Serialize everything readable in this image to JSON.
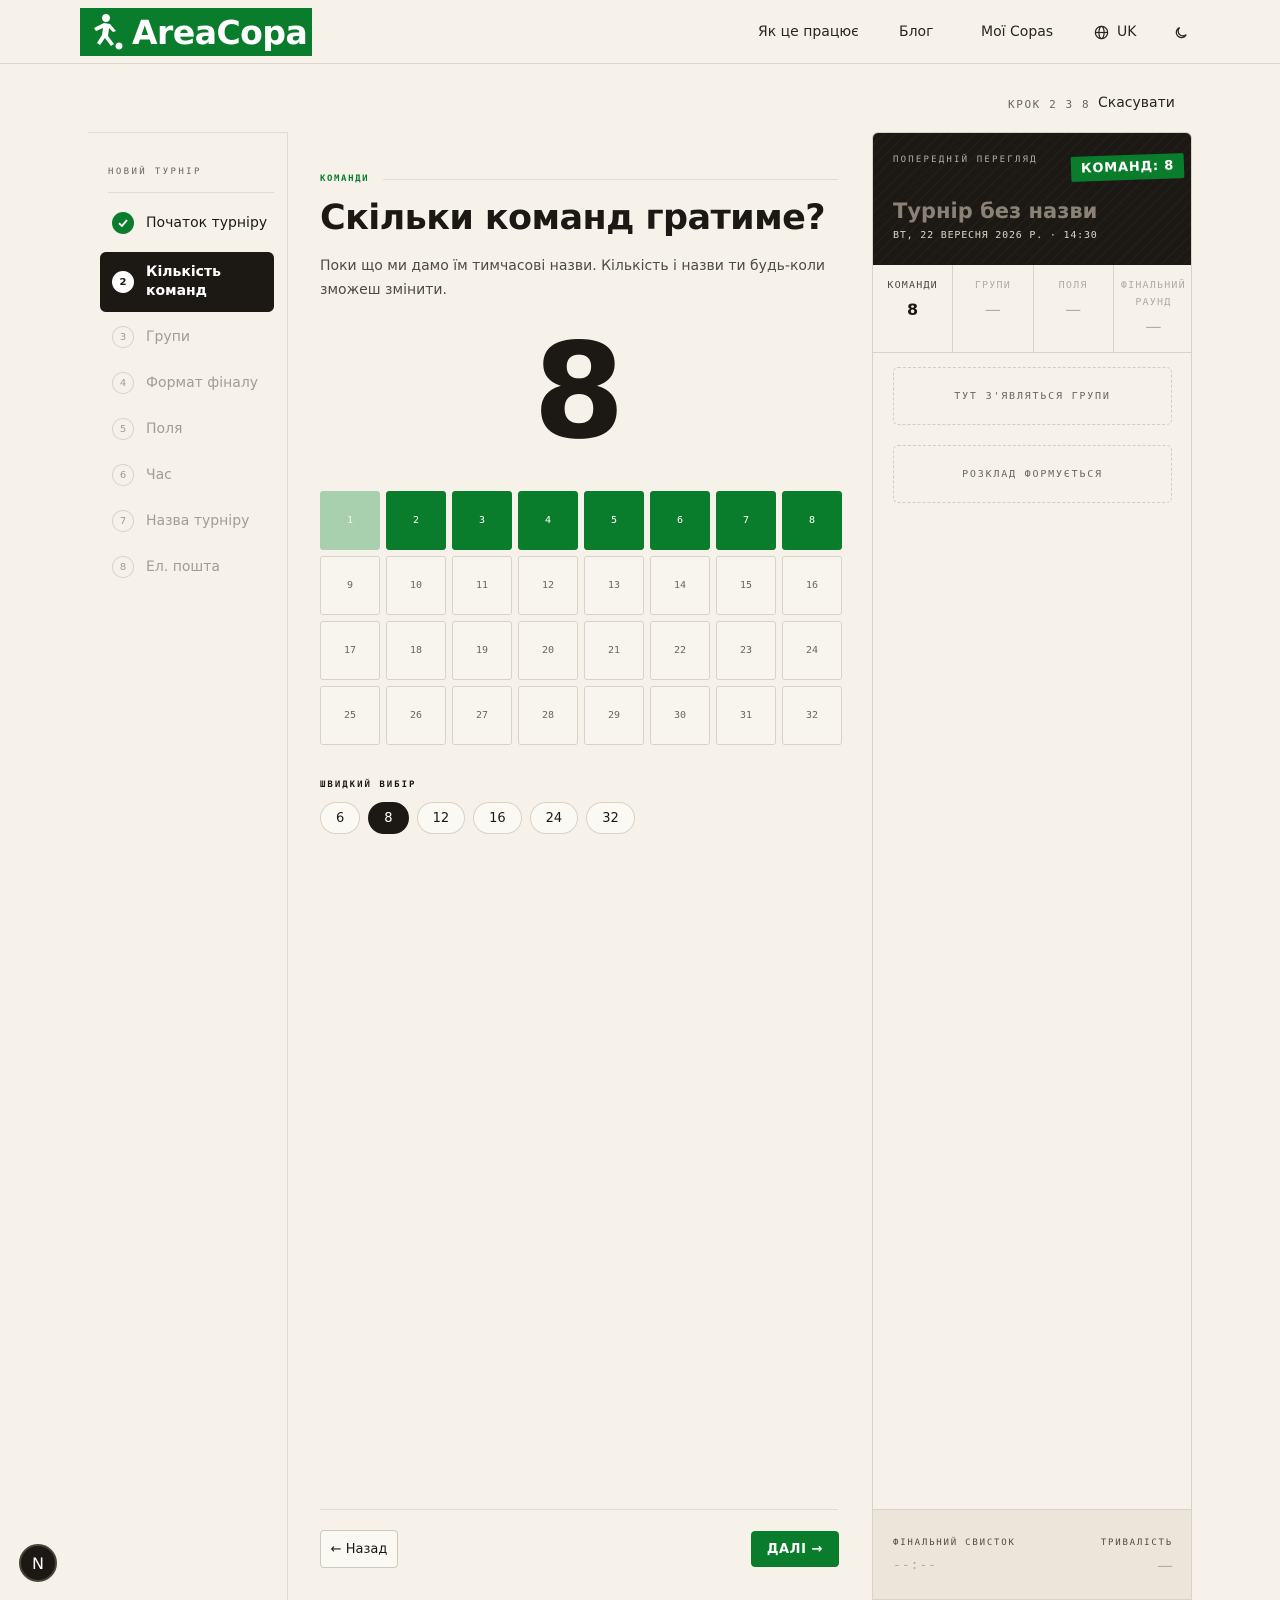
{
  "header": {
    "logo_text": "AreaCopa",
    "nav": {
      "how_it_works": "Як це працює",
      "blog": "Блог",
      "my_copas": "Мої Copas",
      "language": "UK"
    }
  },
  "stepbar": {
    "label": "КРОК 2 З 8",
    "cancel": "Скасувати"
  },
  "sidebar": {
    "heading": "НОВИЙ ТУРНІР",
    "steps": [
      {
        "num": "1",
        "label": "Початок турніру",
        "state": "done"
      },
      {
        "num": "2",
        "label": "Кількість команд",
        "state": "active"
      },
      {
        "num": "3",
        "label": "Групи",
        "state": "pending"
      },
      {
        "num": "4",
        "label": "Формат фіналу",
        "state": "pending"
      },
      {
        "num": "5",
        "label": "Поля",
        "state": "pending"
      },
      {
        "num": "6",
        "label": "Час",
        "state": "pending"
      },
      {
        "num": "7",
        "label": "Назва турніру",
        "state": "pending"
      },
      {
        "num": "8",
        "label": "Ел. пошта",
        "state": "pending"
      }
    ]
  },
  "main": {
    "eyebrow": "КОМАНДИ",
    "title": "Скільки команд гратиме?",
    "subtitle": "Поки що ми дамо їм тимчасові назви. Кількість і назви ти будь-коли зможеш змінити.",
    "team_count": "8",
    "grid": [
      "1",
      "2",
      "3",
      "4",
      "5",
      "6",
      "7",
      "8",
      "9",
      "10",
      "11",
      "12",
      "13",
      "14",
      "15",
      "16",
      "17",
      "18",
      "19",
      "20",
      "21",
      "22",
      "23",
      "24",
      "25",
      "26",
      "27",
      "28",
      "29",
      "30",
      "31",
      "32"
    ],
    "selected_count": 8,
    "quick_label": "ШВИДКИЙ ВИБІР",
    "quick_options": [
      "6",
      "8",
      "12",
      "16",
      "24",
      "32"
    ],
    "quick_selected": "8",
    "back_label": "← Назад",
    "next_label": "ДАЛІ →"
  },
  "preview": {
    "label": "ПОПЕРЕДНІЙ ПЕРЕГЛЯД",
    "badge": "КОМАНД: 8",
    "tournament_name": "Турнір без назви",
    "date": "ВТ, 22 ВЕРЕСНЯ 2026 Р. · 14:30",
    "stats": [
      {
        "label": "КОМАНДИ",
        "value": "8",
        "active": true
      },
      {
        "label": "ГРУПИ",
        "value": "—",
        "active": false
      },
      {
        "label": "ПОЛЯ",
        "value": "—",
        "active": false
      },
      {
        "label": "ФІНАЛЬНИЙ РАУНД",
        "value": "—",
        "active": false
      }
    ],
    "groups_placeholder": "ТУТ З'ЯВЛЯТЬСЯ ГРУПИ",
    "schedule_placeholder": "РОЗКЛАД ФОРМУЄТЬСЯ",
    "final_whistle_label": "ФІНАЛЬНИЙ СВИСТОК",
    "final_whistle_value": "--:--",
    "duration_label": "ТРИВАЛІСТЬ",
    "duration_value": "—"
  },
  "colors": {
    "brand_green": "#0a7d2c",
    "ink": "#1c1814",
    "paper": "#f6f2ea"
  },
  "dev_badge": "N"
}
